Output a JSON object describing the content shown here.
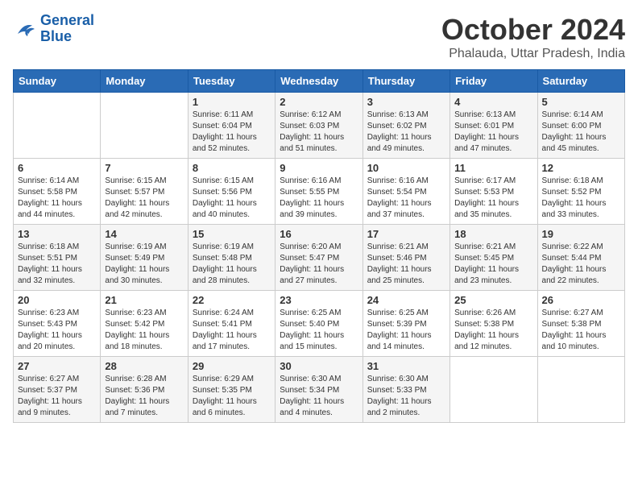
{
  "header": {
    "logo_line1": "General",
    "logo_line2": "Blue",
    "month": "October 2024",
    "location": "Phalauda, Uttar Pradesh, India"
  },
  "weekdays": [
    "Sunday",
    "Monday",
    "Tuesday",
    "Wednesday",
    "Thursday",
    "Friday",
    "Saturday"
  ],
  "weeks": [
    [
      {
        "day": "",
        "sunrise": "",
        "sunset": "",
        "daylight": ""
      },
      {
        "day": "",
        "sunrise": "",
        "sunset": "",
        "daylight": ""
      },
      {
        "day": "1",
        "sunrise": "Sunrise: 6:11 AM",
        "sunset": "Sunset: 6:04 PM",
        "daylight": "Daylight: 11 hours and 52 minutes."
      },
      {
        "day": "2",
        "sunrise": "Sunrise: 6:12 AM",
        "sunset": "Sunset: 6:03 PM",
        "daylight": "Daylight: 11 hours and 51 minutes."
      },
      {
        "day": "3",
        "sunrise": "Sunrise: 6:13 AM",
        "sunset": "Sunset: 6:02 PM",
        "daylight": "Daylight: 11 hours and 49 minutes."
      },
      {
        "day": "4",
        "sunrise": "Sunrise: 6:13 AM",
        "sunset": "Sunset: 6:01 PM",
        "daylight": "Daylight: 11 hours and 47 minutes."
      },
      {
        "day": "5",
        "sunrise": "Sunrise: 6:14 AM",
        "sunset": "Sunset: 6:00 PM",
        "daylight": "Daylight: 11 hours and 45 minutes."
      }
    ],
    [
      {
        "day": "6",
        "sunrise": "Sunrise: 6:14 AM",
        "sunset": "Sunset: 5:58 PM",
        "daylight": "Daylight: 11 hours and 44 minutes."
      },
      {
        "day": "7",
        "sunrise": "Sunrise: 6:15 AM",
        "sunset": "Sunset: 5:57 PM",
        "daylight": "Daylight: 11 hours and 42 minutes."
      },
      {
        "day": "8",
        "sunrise": "Sunrise: 6:15 AM",
        "sunset": "Sunset: 5:56 PM",
        "daylight": "Daylight: 11 hours and 40 minutes."
      },
      {
        "day": "9",
        "sunrise": "Sunrise: 6:16 AM",
        "sunset": "Sunset: 5:55 PM",
        "daylight": "Daylight: 11 hours and 39 minutes."
      },
      {
        "day": "10",
        "sunrise": "Sunrise: 6:16 AM",
        "sunset": "Sunset: 5:54 PM",
        "daylight": "Daylight: 11 hours and 37 minutes."
      },
      {
        "day": "11",
        "sunrise": "Sunrise: 6:17 AM",
        "sunset": "Sunset: 5:53 PM",
        "daylight": "Daylight: 11 hours and 35 minutes."
      },
      {
        "day": "12",
        "sunrise": "Sunrise: 6:18 AM",
        "sunset": "Sunset: 5:52 PM",
        "daylight": "Daylight: 11 hours and 33 minutes."
      }
    ],
    [
      {
        "day": "13",
        "sunrise": "Sunrise: 6:18 AM",
        "sunset": "Sunset: 5:51 PM",
        "daylight": "Daylight: 11 hours and 32 minutes."
      },
      {
        "day": "14",
        "sunrise": "Sunrise: 6:19 AM",
        "sunset": "Sunset: 5:49 PM",
        "daylight": "Daylight: 11 hours and 30 minutes."
      },
      {
        "day": "15",
        "sunrise": "Sunrise: 6:19 AM",
        "sunset": "Sunset: 5:48 PM",
        "daylight": "Daylight: 11 hours and 28 minutes."
      },
      {
        "day": "16",
        "sunrise": "Sunrise: 6:20 AM",
        "sunset": "Sunset: 5:47 PM",
        "daylight": "Daylight: 11 hours and 27 minutes."
      },
      {
        "day": "17",
        "sunrise": "Sunrise: 6:21 AM",
        "sunset": "Sunset: 5:46 PM",
        "daylight": "Daylight: 11 hours and 25 minutes."
      },
      {
        "day": "18",
        "sunrise": "Sunrise: 6:21 AM",
        "sunset": "Sunset: 5:45 PM",
        "daylight": "Daylight: 11 hours and 23 minutes."
      },
      {
        "day": "19",
        "sunrise": "Sunrise: 6:22 AM",
        "sunset": "Sunset: 5:44 PM",
        "daylight": "Daylight: 11 hours and 22 minutes."
      }
    ],
    [
      {
        "day": "20",
        "sunrise": "Sunrise: 6:23 AM",
        "sunset": "Sunset: 5:43 PM",
        "daylight": "Daylight: 11 hours and 20 minutes."
      },
      {
        "day": "21",
        "sunrise": "Sunrise: 6:23 AM",
        "sunset": "Sunset: 5:42 PM",
        "daylight": "Daylight: 11 hours and 18 minutes."
      },
      {
        "day": "22",
        "sunrise": "Sunrise: 6:24 AM",
        "sunset": "Sunset: 5:41 PM",
        "daylight": "Daylight: 11 hours and 17 minutes."
      },
      {
        "day": "23",
        "sunrise": "Sunrise: 6:25 AM",
        "sunset": "Sunset: 5:40 PM",
        "daylight": "Daylight: 11 hours and 15 minutes."
      },
      {
        "day": "24",
        "sunrise": "Sunrise: 6:25 AM",
        "sunset": "Sunset: 5:39 PM",
        "daylight": "Daylight: 11 hours and 14 minutes."
      },
      {
        "day": "25",
        "sunrise": "Sunrise: 6:26 AM",
        "sunset": "Sunset: 5:38 PM",
        "daylight": "Daylight: 11 hours and 12 minutes."
      },
      {
        "day": "26",
        "sunrise": "Sunrise: 6:27 AM",
        "sunset": "Sunset: 5:38 PM",
        "daylight": "Daylight: 11 hours and 10 minutes."
      }
    ],
    [
      {
        "day": "27",
        "sunrise": "Sunrise: 6:27 AM",
        "sunset": "Sunset: 5:37 PM",
        "daylight": "Daylight: 11 hours and 9 minutes."
      },
      {
        "day": "28",
        "sunrise": "Sunrise: 6:28 AM",
        "sunset": "Sunset: 5:36 PM",
        "daylight": "Daylight: 11 hours and 7 minutes."
      },
      {
        "day": "29",
        "sunrise": "Sunrise: 6:29 AM",
        "sunset": "Sunset: 5:35 PM",
        "daylight": "Daylight: 11 hours and 6 minutes."
      },
      {
        "day": "30",
        "sunrise": "Sunrise: 6:30 AM",
        "sunset": "Sunset: 5:34 PM",
        "daylight": "Daylight: 11 hours and 4 minutes."
      },
      {
        "day": "31",
        "sunrise": "Sunrise: 6:30 AM",
        "sunset": "Sunset: 5:33 PM",
        "daylight": "Daylight: 11 hours and 2 minutes."
      },
      {
        "day": "",
        "sunrise": "",
        "sunset": "",
        "daylight": ""
      },
      {
        "day": "",
        "sunrise": "",
        "sunset": "",
        "daylight": ""
      }
    ]
  ]
}
